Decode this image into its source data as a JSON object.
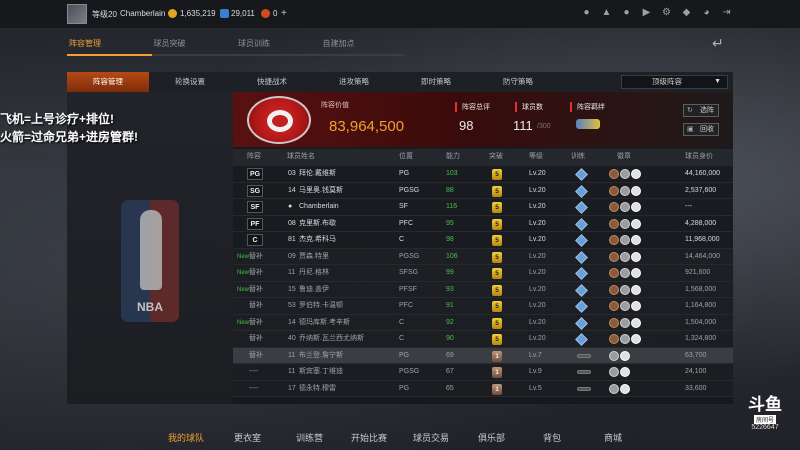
{
  "topbar": {
    "level": "等级20",
    "username": "Chamberlain",
    "coins": "1,635,219",
    "points": "29,011",
    "tickets": "0",
    "plus": "+",
    "icons": [
      "person-icon",
      "bell-icon",
      "friends-icon",
      "video-icon",
      "settings-icon",
      "shield-icon",
      "headset-icon",
      "exit-icon"
    ]
  },
  "main_tabs": [
    {
      "label": "阵容管理",
      "active": true
    },
    {
      "label": "球员突破",
      "active": false
    },
    {
      "label": "球员训练",
      "active": false
    },
    {
      "label": "自建加点",
      "active": false
    }
  ],
  "sub_tabs": [
    {
      "label": "阵容管理",
      "active": true
    },
    {
      "label": "轮换设置",
      "active": false
    },
    {
      "label": "快捷战术",
      "active": false
    },
    {
      "label": "进攻策略",
      "active": false
    },
    {
      "label": "即时策略",
      "active": false
    },
    {
      "label": "防守策略",
      "active": false
    }
  ],
  "lineup_select": {
    "value": "顶级阵容"
  },
  "team": {
    "value_label": "阵容价值",
    "value": "83,964,500",
    "score_label": "阵容总评",
    "score": "98",
    "players_label": "球员数",
    "players": "111",
    "players_max": "/300",
    "bond_label": "阵容羁绊",
    "select_button": "选阵",
    "recycle_button": "回收"
  },
  "overlay": {
    "line1": "飞机=上号诊疗+排位!",
    "line2": "火箭=过命兄弟+进房管群!"
  },
  "nba_logo_text": "NBA",
  "table": {
    "headers": {
      "lineup": "阵容",
      "name": "球员姓名",
      "position": "位置",
      "ability": "能力",
      "breakthrough": "突破",
      "level": "等级",
      "training": "训练",
      "badge": "徽章",
      "value": "球员身价"
    },
    "rows": [
      {
        "slot": "PG",
        "num": "03",
        "name": "拜伦.戴维斯",
        "pos": "PG",
        "ability": "103",
        "att": "5",
        "level": "Lv.20",
        "gem": "4",
        "value": "44,160,000"
      },
      {
        "slot": "SG",
        "num": "14",
        "name": "马里奥.钱莫斯",
        "pos": "PGSG",
        "ability": "88",
        "att": "5",
        "level": "Lv.20",
        "gem": "4",
        "value": "2,537,600"
      },
      {
        "slot": "SF",
        "num": "",
        "name": "Chamberlain",
        "pos": "SF",
        "ability": "116",
        "att": "5",
        "level": "Lv.20",
        "gem": "4",
        "value": "---"
      },
      {
        "slot": "PF",
        "num": "08",
        "name": "克里斯.布歇",
        "pos": "PFC",
        "ability": "95",
        "att": "5",
        "level": "Lv.20",
        "gem": "4",
        "value": "4,288,000"
      },
      {
        "slot": "C",
        "num": "81",
        "name": "杰克.希科马",
        "pos": "C",
        "ability": "98",
        "att": "5",
        "level": "Lv.20",
        "gem": "4",
        "value": "11,968,000"
      },
      {
        "slot": "替补",
        "new": "New",
        "num": "09",
        "name": "贾森.特里",
        "pos": "PGSG",
        "ability": "106",
        "att": "5",
        "level": "Lv.20",
        "gem": "4",
        "value": "14,464,000"
      },
      {
        "slot": "替补",
        "new": "New",
        "num": "11",
        "name": "丹尼.格林",
        "pos": "SFSG",
        "ability": "99",
        "att": "5",
        "level": "Lv.20",
        "gem": "4",
        "value": "921,600"
      },
      {
        "slot": "替补",
        "new": "New",
        "num": "15",
        "name": "鲁迪.盖伊",
        "pos": "PFSF",
        "ability": "93",
        "att": "5",
        "level": "Lv.20",
        "gem": "4",
        "value": "1,568,000"
      },
      {
        "slot": "替补",
        "num": "53",
        "name": "罗伯特.卡温顿",
        "pos": "PFC",
        "ability": "91",
        "att": "5",
        "level": "Lv.20",
        "gem": "4",
        "value": "1,164,800"
      },
      {
        "slot": "替补",
        "new": "New",
        "num": "14",
        "name": "德玛库斯.考辛斯",
        "pos": "C",
        "ability": "92",
        "att": "5",
        "level": "Lv.20",
        "gem": "4",
        "value": "1,504,000"
      },
      {
        "slot": "替补",
        "num": "40",
        "name": "乔纳斯.瓦兰西尤纳斯",
        "pos": "C",
        "ability": "90",
        "att": "5",
        "level": "Lv.20",
        "gem": "4",
        "value": "1,324,800"
      },
      {
        "slot": "替补",
        "num": "11",
        "name": "布兰登.詹宁斯",
        "pos": "PG",
        "ability": "69",
        "att": "1",
        "level": "Lv.7",
        "gem": "",
        "value": "63,700",
        "highlight": true
      },
      {
        "slot": "----",
        "num": "11",
        "name": "斯宾塞.丁维迪",
        "pos": "PGSG",
        "ability": "67",
        "att": "1",
        "level": "Lv.9",
        "gem": "",
        "value": "24,100"
      },
      {
        "slot": "----",
        "num": "17",
        "name": "德永特.穆雷",
        "pos": "PG",
        "ability": "65",
        "att": "1",
        "level": "Lv.5",
        "gem": "",
        "value": "33,600"
      }
    ]
  },
  "bottom_nav": [
    {
      "label": "我的球队",
      "active": true
    },
    {
      "label": "更衣室",
      "active": false
    },
    {
      "label": "训练营",
      "active": false
    },
    {
      "label": "开始比赛",
      "active": false
    },
    {
      "label": "球员交易",
      "active": false
    },
    {
      "label": "俱乐部",
      "active": false
    },
    {
      "label": "背包",
      "active": false
    },
    {
      "label": "商城",
      "active": false
    }
  ],
  "watermark": {
    "brand": "斗鱼",
    "room_label": "房间号",
    "room_number": "5226647"
  },
  "colors": {
    "accent": "#f0a030",
    "active_tab": "#b44a14",
    "team_red": "#d92a2a",
    "ability_green": "#45c24a"
  }
}
